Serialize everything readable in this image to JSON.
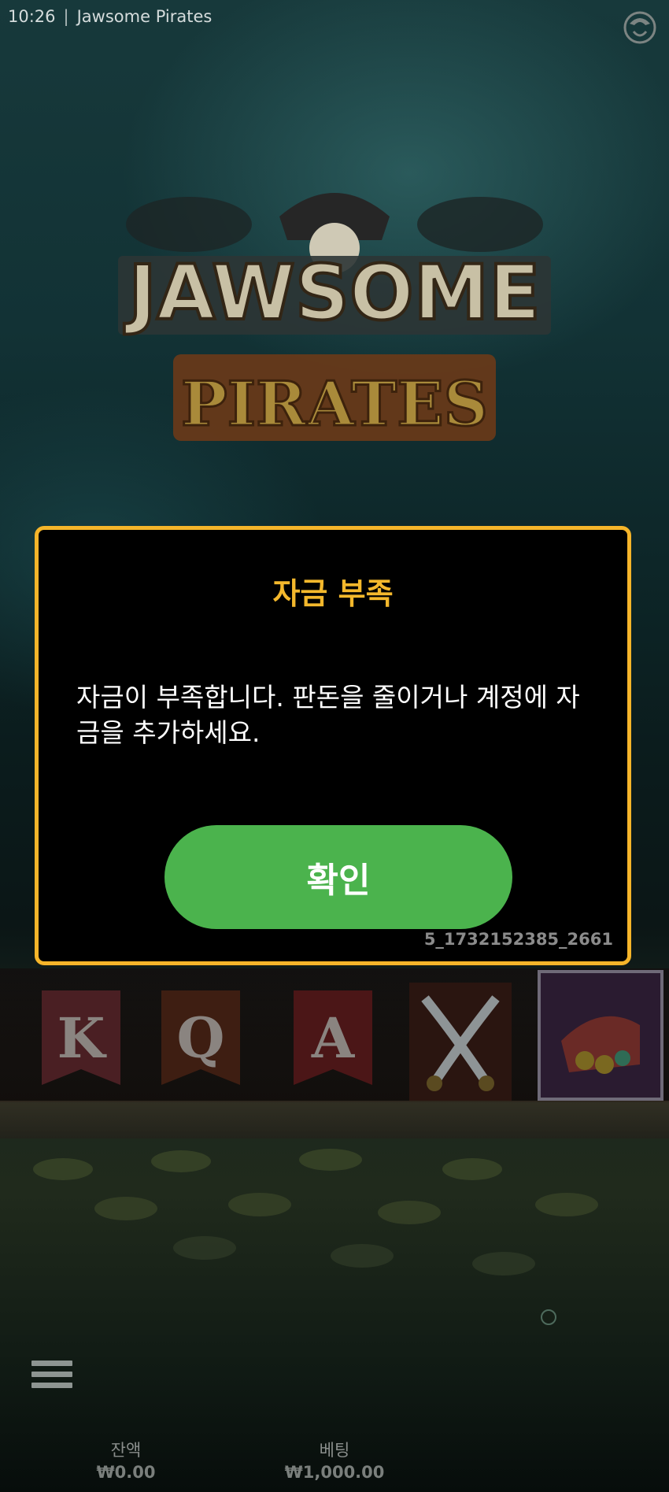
{
  "status_bar": {
    "time": "10:26",
    "separator": "|",
    "game_name": "Jawsome Pirates"
  },
  "game_logo": {
    "line1": "JAWSOME",
    "line2": "PIRATES"
  },
  "reel_symbols": [
    "K",
    "Q",
    "A",
    "crossed-swords",
    "treasure-chest"
  ],
  "modal": {
    "title": "자금 부족",
    "message": "자금이 부족합니다. 판돈을 줄이거나 계정에 자금을 추가하세요.",
    "confirm_label": "확인",
    "error_code": "5_1732152385_2661"
  },
  "footer": {
    "balance_label": "잔액",
    "balance_value": "₩0.00",
    "bet_label": "베팅",
    "bet_value": "₩1,000.00"
  },
  "colors": {
    "modal_border": "#f5b52a",
    "modal_title": "#f4b82c",
    "confirm_button": "#4bb34d"
  }
}
